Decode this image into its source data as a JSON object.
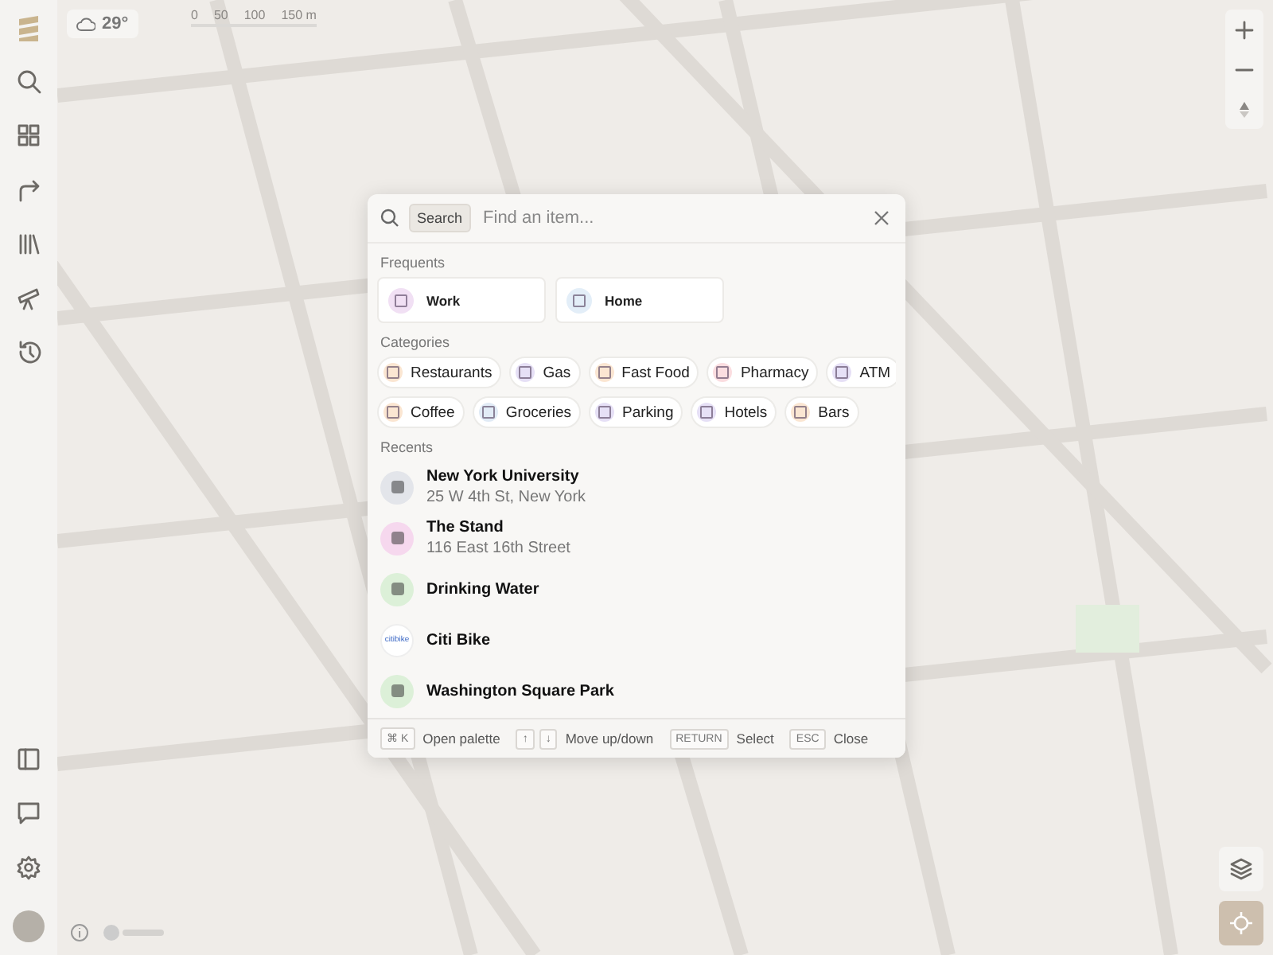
{
  "weather": {
    "temperature": "29°"
  },
  "scale": {
    "labels": [
      "0",
      "50",
      "100",
      "150 m"
    ]
  },
  "palette": {
    "search": {
      "badge": "Search",
      "placeholder": "Find an item..."
    },
    "frequents": {
      "title": "Frequents",
      "items": [
        {
          "label": "Work",
          "color": "#f1e0f4"
        },
        {
          "label": "Home",
          "color": "#e3eef8"
        }
      ]
    },
    "categories": {
      "title": "Categories",
      "rows": [
        [
          {
            "label": "Restaurants",
            "color": "#fbe6d2"
          },
          {
            "label": "Gas",
            "color": "#e6e0f6"
          },
          {
            "label": "Fast Food",
            "color": "#fbe6d2"
          },
          {
            "label": "Pharmacy",
            "color": "#fbdde0"
          },
          {
            "label": "ATM",
            "color": "#e6e0f6"
          }
        ],
        [
          {
            "label": "Coffee",
            "color": "#fbe6d2"
          },
          {
            "label": "Groceries",
            "color": "#e1ebf6"
          },
          {
            "label": "Parking",
            "color": "#e6e0f6"
          },
          {
            "label": "Hotels",
            "color": "#e6e0f6"
          },
          {
            "label": "Bars",
            "color": "#fbe6d2"
          }
        ]
      ]
    },
    "recents": {
      "title": "Recents",
      "items": [
        {
          "kind": "place",
          "title": "New York University",
          "subtitle": "25 W 4th St, New York",
          "color": "#e3e5ea"
        },
        {
          "kind": "place",
          "title": "The Stand",
          "subtitle": "116 East 16th Street",
          "color": "#f6d8ee"
        },
        {
          "kind": "place",
          "title": "Drinking Water",
          "color": "#dcf0d8"
        },
        {
          "kind": "logo",
          "title": "Citi Bike",
          "logo": "citibike",
          "color": "#ffffff"
        },
        {
          "kind": "place",
          "title": "Washington Square Park",
          "color": "#dcf0d8"
        }
      ]
    },
    "hints": [
      {
        "keys": [
          "⌘ K"
        ],
        "label": "Open palette"
      },
      {
        "keys": [
          "↑",
          "↓"
        ],
        "label": "Move up/down"
      },
      {
        "keys": [
          "RETURN"
        ],
        "label": "Select"
      },
      {
        "keys": [
          "ESC"
        ],
        "label": "Close"
      }
    ]
  }
}
